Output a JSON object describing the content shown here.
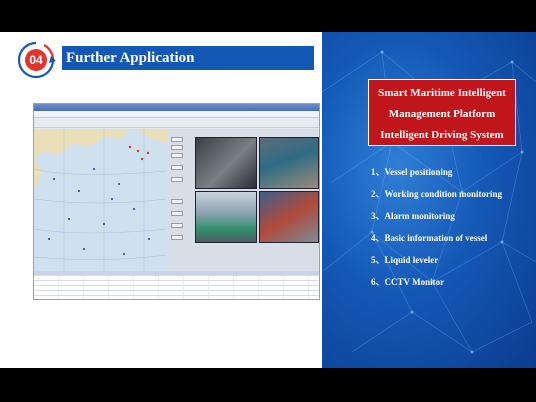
{
  "section": {
    "number": "04",
    "title": "Further Application"
  },
  "info_box": {
    "lines": [
      "Smart Maritime Intelligent",
      "Management Platform",
      "Intelligent Driving System"
    ]
  },
  "features": [
    "1、Vessel positioning",
    "2、Working condition monitoring",
    "3、Alarm monitoring",
    "4、Basic information of vessel",
    "5、Liquid leveler",
    "6、CCTV Monitor"
  ],
  "colors": {
    "accent_red": "#c0161b",
    "badge_red": "#e2342b",
    "brand_blue": "#1458b6"
  },
  "icons": {
    "badge": "circular-arrow-badge",
    "screenshot": "software-window-screenshot"
  }
}
